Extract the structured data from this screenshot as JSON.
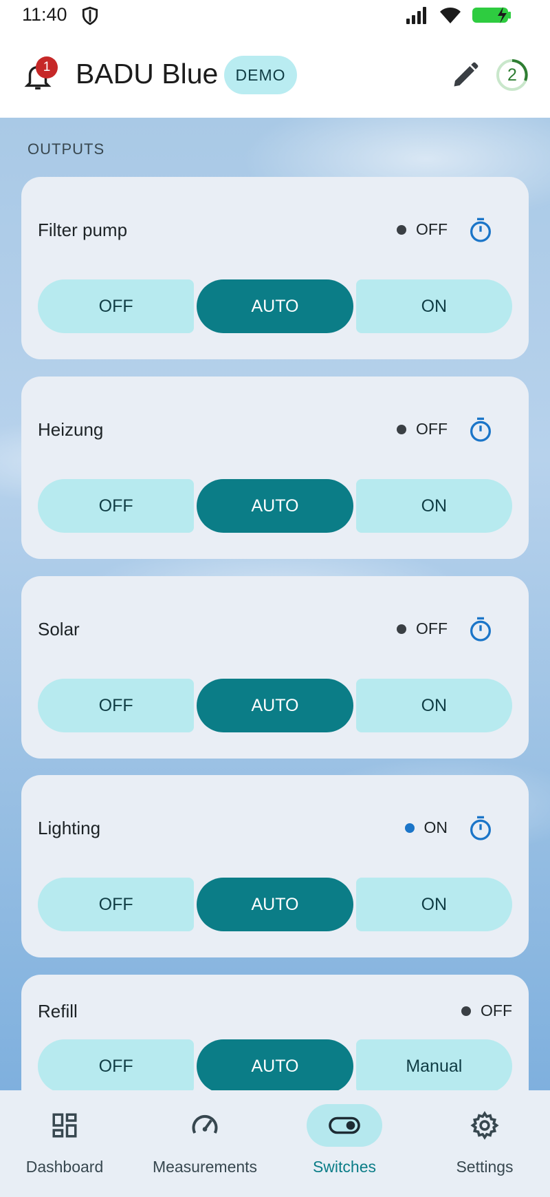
{
  "status_bar": {
    "time": "11:40"
  },
  "header": {
    "title": "BADU Blue",
    "demo_chip": "DEMO",
    "notification_count": "1",
    "counter": "2"
  },
  "section": {
    "title": "OUTPUTS"
  },
  "outputs": [
    {
      "name": "Filter pump",
      "state": "OFF",
      "buttons": [
        "OFF",
        "AUTO",
        "ON"
      ],
      "selected": "AUTO"
    },
    {
      "name": "Heizung",
      "state": "OFF",
      "buttons": [
        "OFF",
        "AUTO",
        "ON"
      ],
      "selected": "AUTO"
    },
    {
      "name": "Solar",
      "state": "OFF",
      "buttons": [
        "OFF",
        "AUTO",
        "ON"
      ],
      "selected": "AUTO"
    },
    {
      "name": "Lighting",
      "state": "ON",
      "buttons": [
        "OFF",
        "AUTO",
        "ON"
      ],
      "selected": "AUTO"
    },
    {
      "name": "Refill",
      "state": "OFF",
      "buttons": [
        "OFF",
        "AUTO",
        "Manual"
      ],
      "selected": "AUTO"
    }
  ],
  "nav": {
    "items": [
      {
        "label": "Dashboard",
        "icon": "dashboard-icon"
      },
      {
        "label": "Measurements",
        "icon": "speedometer-icon"
      },
      {
        "label": "Switches",
        "icon": "toggle-icon",
        "active": true
      },
      {
        "label": "Settings",
        "icon": "gear-icon"
      }
    ]
  },
  "colors": {
    "accent": "#0b7d87",
    "chip": "#b7eaef",
    "card": "#e9eef5",
    "on_dot": "#1b75c8",
    "badge": "#c62828"
  }
}
